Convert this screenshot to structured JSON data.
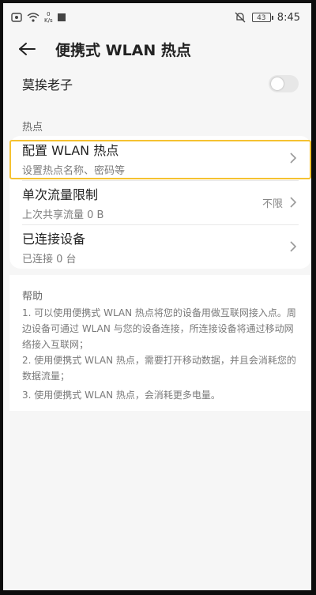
{
  "status_bar": {
    "net_speed_value": "0",
    "net_speed_unit": "K/s",
    "battery": "43",
    "time": "8:45"
  },
  "header": {
    "title": "便携式 WLAN 热点"
  },
  "hotspot_name": {
    "label": "莫挨老子",
    "toggle_on": false
  },
  "section_hotspot": {
    "label": "热点",
    "items": [
      {
        "title": "配置 WLAN 热点",
        "subtitle": "设置热点名称、密码等"
      },
      {
        "title": "单次流量限制",
        "subtitle": "上次共享流量 0 B",
        "value": "不限"
      },
      {
        "title": "已连接设备",
        "subtitle": "已连接 0 台"
      }
    ]
  },
  "help": {
    "label": "帮助",
    "p1": "1. 可以使用便携式 WLAN 热点将您的设备用做互联网接入点。周边设备可通过 WLAN 与您的设备连接，所连接设备将通过移动网络接入互联网；",
    "p2": "2. 使用便携式 WLAN 热点，需要打开移动数据，并且会消耗您的数据流量；",
    "p3": "3. 使用便携式 WLAN 热点，会消耗更多电量。"
  }
}
